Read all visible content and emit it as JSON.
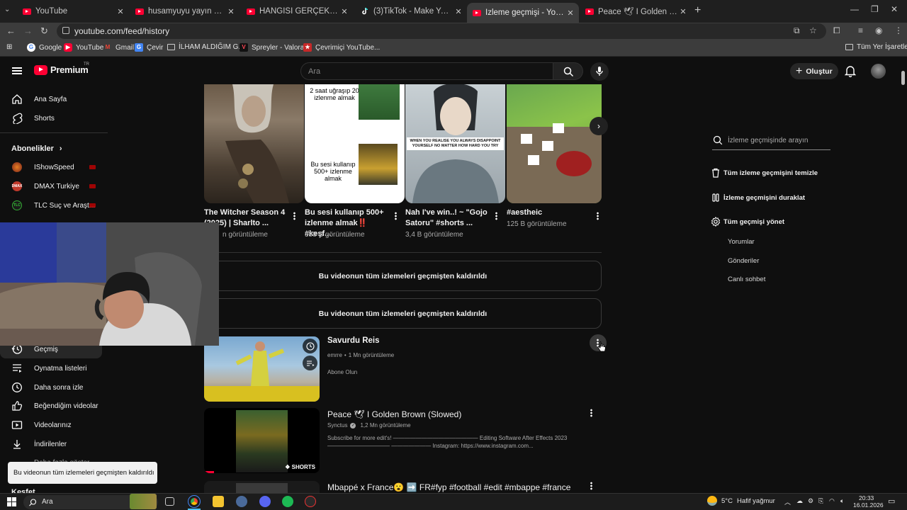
{
  "browser": {
    "tabs": [
      {
        "title": "YouTube",
        "active": false
      },
      {
        "title": "husamyuyu yayın vakti 14 - You",
        "active": false
      },
      {
        "title": "HANGİSİ GERÇEK PİLOT?! ft. @",
        "active": false
      },
      {
        "title": "(3)TikTok - Make Your Day",
        "active": false
      },
      {
        "title": "İzleme geçmişi - YouTube",
        "active": true
      },
      {
        "title": "Peace 🕊 I Golden Brown (Slow",
        "active": false
      }
    ],
    "url": "youtube.com/feed/history",
    "bookmarks": [
      "Google",
      "YouTube",
      "Gmail",
      "Çevir",
      "İLHAM ALDIĞIM G...",
      "Spreyler - Valorant",
      "Çevrimiçi YouTube..."
    ],
    "all_bookmarks": "Tüm Yer İşaretleri"
  },
  "masthead": {
    "logo": "Premium",
    "region": "TR",
    "search_placeholder": "Ara",
    "create_label": "Oluştur"
  },
  "sidebar": {
    "top": [
      "Ana Sayfa",
      "Shorts"
    ],
    "subscriptions_title": "Abonelikler",
    "channels": [
      {
        "name": "IShowSpeed",
        "badge": "",
        "color": "#c0392b"
      },
      {
        "name": "DMAX Turkiye",
        "badge": "DMAX",
        "color": "#d35400"
      },
      {
        "name": "TLC Suç ve Araşt...",
        "badge": "TLC",
        "color": "#1e8449"
      }
    ],
    "you": [
      "Geçmiş",
      "Oynatma listeleri",
      "Daha sonra izle",
      "Beğendiğim videolar",
      "Videolarınız",
      "İndirilenler"
    ],
    "more": "Daha fazla göster",
    "explore": "Keşfet"
  },
  "shorts": [
    {
      "title": "The Witcher Season 4 (2025) | Sharlto ...",
      "views": "n görüntüleme",
      "overlay": []
    },
    {
      "title": "Bu sesi kullanıp 500+ izlenme almak‼️ #keşf...",
      "views": "388 B görüntüleme",
      "overlay": [
        "2 saat uğraşıp 20 izlenme almak",
        "Bu sesi kullanıp 500+ izlenme almak"
      ]
    },
    {
      "title": "Nah I've win..! ~ \"Gojo Satoru\" #shorts ...",
      "views": "3,4 B görüntüleme",
      "overlay": [
        "WHEN YOU REALISE YOU ALWAYS DISAPPOINT YOURSELF NO MATTER HOW HARD YOU TRY"
      ]
    },
    {
      "title": "#aestheic",
      "views": "125 B görüntüleme",
      "overlay": []
    }
  ],
  "removed_message": "Bu videonun tüm izlemeleri geçmişten kaldırıldı",
  "videos": [
    {
      "title": "Savurdu Reis",
      "channel": "emrre",
      "views": "1 Mn görüntüleme",
      "description": "Abone Olun",
      "verified": false,
      "is_short": false
    },
    {
      "title": "Peace 🕊 I Golden Brown (Slowed)",
      "channel": "Synctus",
      "views": "1,2 Mn görüntüleme",
      "description": "Subscribe for more edit's! ——————————————— Editing Software After Effects 2023 ——————————— ——————— Instagram: https://www.instagram.com...",
      "verified": true,
      "is_short": true,
      "badge": "SHORTS"
    },
    {
      "title": "Mbappé x France😮 ➡️ FR#fyp #football #edit #mbappe #france",
      "channel": "",
      "views": "",
      "description": "",
      "verified": false,
      "is_short": false
    }
  ],
  "history_panel": {
    "search_placeholder": "İzleme geçmişinde arayın",
    "actions": [
      "Tüm izleme geçmişini temizle",
      "İzleme geçmişini duraklat",
      "Tüm geçmişi yönet"
    ],
    "sub_items": [
      "Yorumlar",
      "Gönderiler",
      "Canlı sohbet"
    ]
  },
  "toast": "Bu videonun tüm izlemeleri geçmişten kaldırıldı",
  "taskbar": {
    "search_placeholder": "Ara",
    "weather_temp": "5°C",
    "weather_text": "Hafif yağmur",
    "time": "20:33",
    "date": "16.01.2026"
  }
}
